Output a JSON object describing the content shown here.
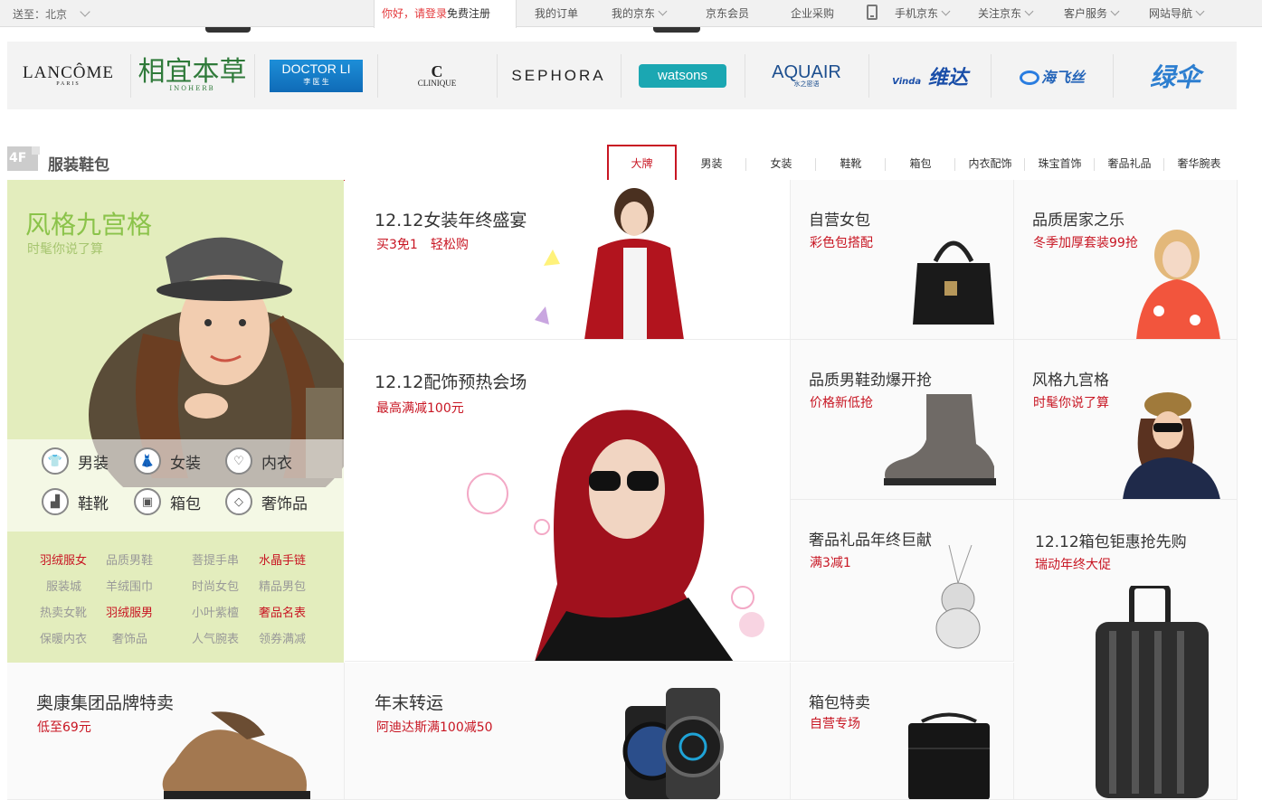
{
  "topbar": {
    "location": "送至：北京",
    "greeting": "你好，请登录",
    "register": "免费注册",
    "nav": [
      {
        "label": "我的订单",
        "dropdown": false
      },
      {
        "label": "我的京东",
        "dropdown": true
      },
      {
        "label": "京东会员",
        "dropdown": false
      },
      {
        "label": "企业采购",
        "dropdown": false
      },
      {
        "label": "手机京东",
        "dropdown": true
      },
      {
        "label": "关注京东",
        "dropdown": true
      },
      {
        "label": "客户服务",
        "dropdown": true
      },
      {
        "label": "网站导航",
        "dropdown": true
      }
    ]
  },
  "brands": {
    "lancome": {
      "name": "LANCÔME",
      "sub": "PARIS"
    },
    "inoherb": {
      "name": "相宜本草",
      "sub": "INOHERB"
    },
    "doctorli": {
      "name": "DOCTOR LI",
      "sub": "李 医 生"
    },
    "clinique": {
      "mark": "C",
      "name": "CLINIQUE"
    },
    "sephora": {
      "name": "SEPHORA"
    },
    "watsons": {
      "name": "watsons"
    },
    "aquair": {
      "name": "AQUAIR",
      "sub": "水之密语"
    },
    "vinda": {
      "name": "维达",
      "sub": "Vinda"
    },
    "flypaper": {
      "name": "海飞丝"
    },
    "lvsan": {
      "name": "绿伞"
    }
  },
  "floor": {
    "badge": "4F",
    "title": "服装鞋包",
    "tabs": [
      "大牌",
      "男装",
      "女装",
      "鞋靴",
      "箱包",
      "内衣配饰",
      "珠宝首饰",
      "奢品礼品",
      "奢华腕表"
    ],
    "active_tab": "大牌"
  },
  "left_promo": {
    "title": "风格九宫格",
    "subtitle": "时髦你说了算",
    "categories": [
      {
        "label": "男装",
        "icon": "shirt-icon"
      },
      {
        "label": "女装",
        "icon": "dress-icon"
      },
      {
        "label": "内衣",
        "icon": "underwear-icon"
      },
      {
        "label": "鞋靴",
        "icon": "boot-icon"
      },
      {
        "label": "箱包",
        "icon": "bag-icon"
      },
      {
        "label": "奢饰品",
        "icon": "diamond-icon"
      }
    ],
    "keywords": [
      [
        {
          "t": "羽绒服女",
          "red": true
        },
        {
          "t": "品质男鞋",
          "red": false
        },
        {
          "t": "菩提手串",
          "red": false
        },
        {
          "t": "水晶手链",
          "red": true
        }
      ],
      [
        {
          "t": "服装城",
          "red": false
        },
        {
          "t": "羊绒围巾",
          "red": false
        },
        {
          "t": "时尚女包",
          "red": false
        },
        {
          "t": "精品男包",
          "red": false
        }
      ],
      [
        {
          "t": "热卖女靴",
          "red": false
        },
        {
          "t": "羽绒服男",
          "red": true
        },
        {
          "t": "小叶紫檀",
          "red": false
        },
        {
          "t": "奢品名表",
          "red": true
        }
      ],
      [
        {
          "t": "保暖内衣",
          "red": false
        },
        {
          "t": "奢饰品",
          "red": false
        },
        {
          "t": "人气腕表",
          "red": false
        },
        {
          "t": "领券满减",
          "red": false
        }
      ]
    ]
  },
  "cells": {
    "womens": {
      "title": "12.12女装年终盛宴",
      "sub": "买3免1　轻松购"
    },
    "accessories": {
      "title": "12.12配饰预热会场",
      "sub": "最高满减100元"
    },
    "handbag": {
      "title": "自营女包",
      "sub": "彩色包搭配"
    },
    "home": {
      "title": "品质居家之乐",
      "sub": "冬季加厚套装99抢"
    },
    "mens_shoes": {
      "title": "品质男鞋劲爆开抢",
      "sub": "价格新低抢"
    },
    "style": {
      "title": "风格九宫格",
      "sub": "时髦你说了算"
    },
    "luxury": {
      "title": "奢品礼品年终巨献",
      "sub": "满3减1"
    },
    "luggage": {
      "title": "12.12箱包钜惠抢先购",
      "sub": "瑞动年终大促"
    },
    "aokang": {
      "title": "奥康集团品牌特卖",
      "sub": "低至69元"
    },
    "watch": {
      "title": "年末转运",
      "sub": "阿迪达斯满100减50"
    },
    "bags_sale": {
      "title": "箱包特卖",
      "sub": "自营专场"
    }
  },
  "colors": {
    "accent": "#c81623",
    "promo_bg": "#e3edbd",
    "promo_title": "#8bc34a"
  }
}
